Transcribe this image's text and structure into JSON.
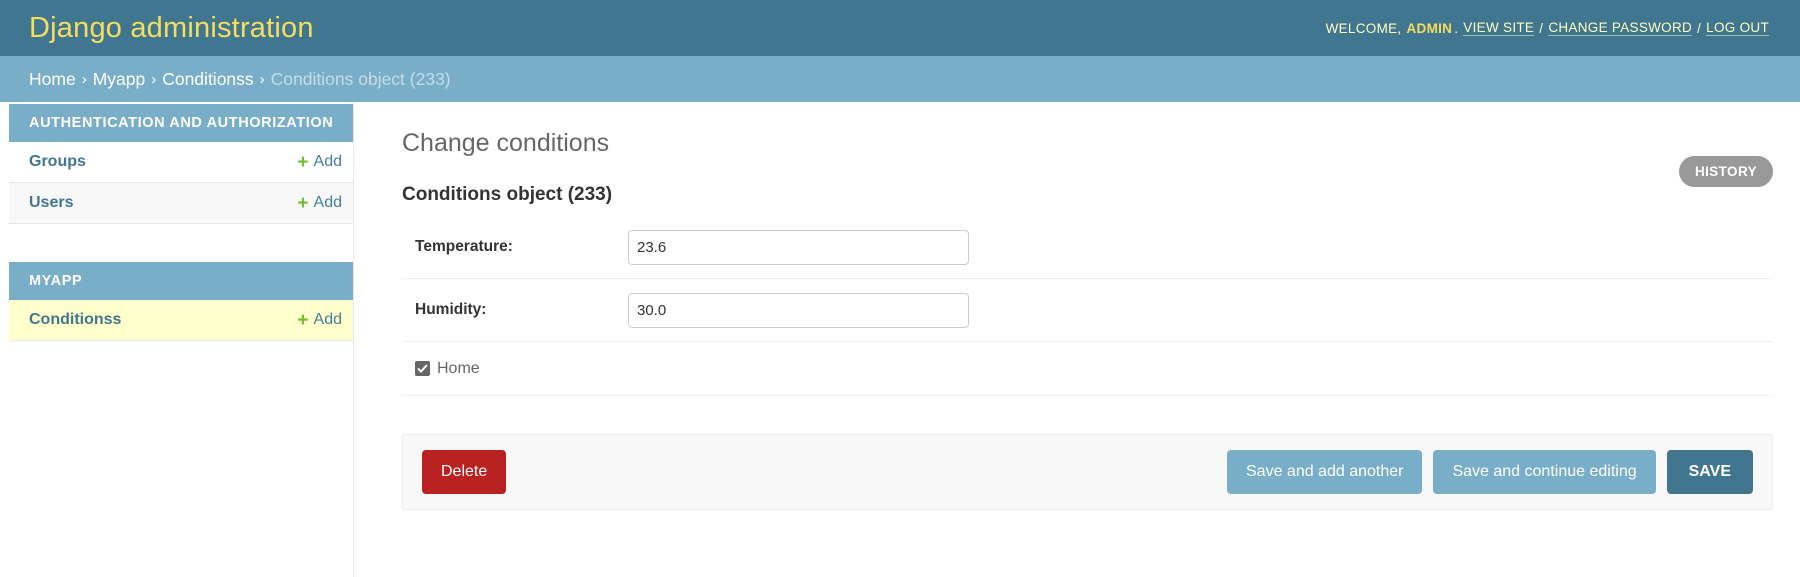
{
  "header": {
    "brand": "Django administration",
    "welcome": "WELCOME,",
    "username": "ADMIN",
    "links": [
      "VIEW SITE",
      "CHANGE PASSWORD",
      "LOG OUT"
    ]
  },
  "breadcrumbs": {
    "items": [
      "Home",
      "Myapp",
      "Conditionss"
    ],
    "current": "Conditions object (233)"
  },
  "sidebar": {
    "modules": [
      {
        "caption": "Authentication and Authorization",
        "rows": [
          {
            "label": "Groups",
            "add": "Add"
          },
          {
            "label": "Users",
            "add": "Add"
          }
        ]
      },
      {
        "caption": "Myapp",
        "rows": [
          {
            "label": "Conditionss",
            "add": "Add"
          }
        ]
      }
    ]
  },
  "content": {
    "title": "Change conditions",
    "history": "HISTORY",
    "object_title": "Conditions object (233)",
    "fields": {
      "temperature_label": "Temperature:",
      "temperature_value": "23.6",
      "humidity_label": "Humidity:",
      "humidity_value": "30.0",
      "home_label": "Home",
      "home_checked": true
    },
    "buttons": {
      "delete": "Delete",
      "save_add": "Save and add another",
      "save_continue": "Save and continue editing",
      "save": "SAVE"
    }
  }
}
